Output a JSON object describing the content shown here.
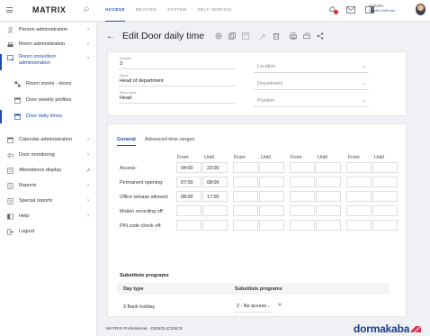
{
  "app": {
    "brand": "MATRIX"
  },
  "top_tabs": [
    "ACCESS",
    "DEVICES",
    "SYSTEM",
    "SELF-SERVICE"
  ],
  "user": {
    "name": "sckrefer",
    "logoff": "Logoff in 899 min"
  },
  "sidebar": {
    "items": [
      {
        "label": "Person administration",
        "icon": "person-icon"
      },
      {
        "label": "Room administration",
        "icon": "room-icon"
      },
      {
        "label": "Room zone/door administration",
        "icon": "room-zone-icon"
      },
      {
        "label": "Room zones - doors",
        "icon": "zones-doors-icon"
      },
      {
        "label": "Door weekly profiles",
        "icon": "calendar-icon"
      },
      {
        "label": "Door daily times",
        "icon": "calendar-icon"
      },
      {
        "label": "Calendar administration",
        "icon": "calendar-icon"
      },
      {
        "label": "Door monitoring",
        "icon": "door-icon"
      },
      {
        "label": "Attendance display",
        "icon": "list-icon"
      },
      {
        "label": "Reports",
        "icon": "report-icon"
      },
      {
        "label": "Special reports",
        "icon": "report-icon"
      },
      {
        "label": "Help",
        "icon": "help-icon"
      },
      {
        "label": "Logout",
        "icon": "logout-icon"
      }
    ]
  },
  "page": {
    "title": "Edit Door daily time"
  },
  "form": {
    "number": {
      "label": "Number",
      "value": "3"
    },
    "name": {
      "label": "Name",
      "value": "Head of department"
    },
    "short_name": {
      "label": "Short name",
      "value": "Head"
    },
    "location": {
      "placeholder": "Location"
    },
    "department": {
      "placeholder": "Department"
    },
    "position": {
      "placeholder": "Position"
    }
  },
  "tabs": [
    "General",
    "Advanced time ranges"
  ],
  "times": {
    "headers": [
      "From",
      "Until",
      "From",
      "Until",
      "From",
      "Until",
      "From",
      "Until"
    ],
    "rows": [
      {
        "label": "Access:",
        "values": [
          "04:00",
          "23:00",
          "",
          "",
          "",
          "",
          "",
          ""
        ]
      },
      {
        "label": "Permanent opening:",
        "values": [
          "07:00",
          "08:00",
          "",
          "",
          "",
          "",
          "",
          ""
        ]
      },
      {
        "label": "Office release allowed:",
        "values": [
          "08:00",
          "17:00",
          "",
          "",
          "",
          "",
          "",
          ""
        ]
      },
      {
        "label": "Motion recording off:",
        "values": [
          "",
          "",
          "",
          "",
          "",
          "",
          "",
          ""
        ]
      },
      {
        "label": "PIN code check off:",
        "values": [
          "",
          "",
          "",
          "",
          "",
          "",
          "",
          ""
        ]
      }
    ]
  },
  "substitute": {
    "title": "Substitute programs",
    "col_day_type": "Day type",
    "col_programs": "Substitute programs",
    "rows": [
      {
        "day_type": "3 Bank holiday",
        "program": "2 - No access"
      }
    ]
  },
  "footer": {
    "copyright": "MATRIX Professional - DEMOLICENCE",
    "logo": "dormakaba"
  },
  "colors": {
    "accent": "#1d4ea8",
    "alert": "#e02a2a",
    "logo": "#1a3d8f",
    "logo_mark": "#e0304e"
  }
}
